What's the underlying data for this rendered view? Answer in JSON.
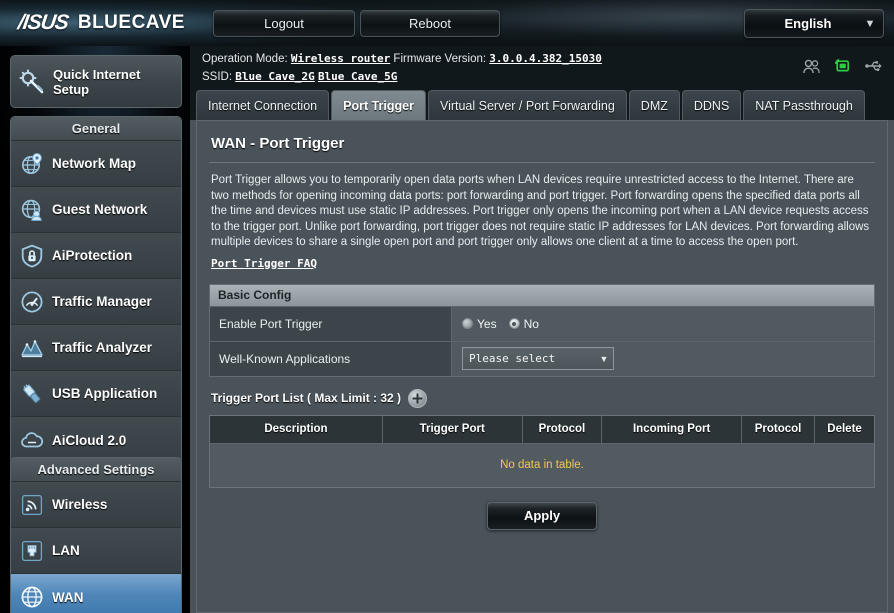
{
  "header": {
    "brand": "/ISUS",
    "model": "BLUECAVE",
    "logout_label": "Logout",
    "reboot_label": "Reboot",
    "language": "English"
  },
  "sidebar": {
    "quick_setup": "Quick Internet Setup",
    "groups": [
      {
        "title": "General",
        "items": [
          {
            "label": "Network Map",
            "icon": "network-map-icon",
            "active": false
          },
          {
            "label": "Guest Network",
            "icon": "guest-network-icon",
            "active": false
          },
          {
            "label": "AiProtection",
            "icon": "shield-lock-icon",
            "active": false
          },
          {
            "label": "Traffic Manager",
            "icon": "gauge-icon",
            "active": false
          },
          {
            "label": "Traffic Analyzer",
            "icon": "chart-icon",
            "active": false
          },
          {
            "label": "USB Application",
            "icon": "usb-icon",
            "active": false
          },
          {
            "label": "AiCloud 2.0",
            "icon": "cloud-icon",
            "active": false
          }
        ]
      },
      {
        "title": "Advanced Settings",
        "items": [
          {
            "label": "Wireless",
            "icon": "wireless-icon",
            "active": false
          },
          {
            "label": "LAN",
            "icon": "lan-port-icon",
            "active": false
          },
          {
            "label": "WAN",
            "icon": "globe-icon",
            "active": true
          }
        ]
      }
    ]
  },
  "status": {
    "operation_mode_label": "Operation Mode:",
    "operation_mode_value": "Wireless router",
    "firmware_label": "Firmware Version:",
    "firmware_value": "3.0.0.4.382_15030",
    "ssid_label": "SSID:",
    "ssid_2g": "Blue Cave_2G",
    "ssid_5g": "Blue Cave_5G",
    "icons": [
      "clients-icon",
      "usb-device-icon",
      "usb-icon"
    ]
  },
  "tabs": [
    {
      "label": "Internet Connection",
      "active": false
    },
    {
      "label": "Port Trigger",
      "active": true
    },
    {
      "label": "Virtual Server / Port Forwarding",
      "active": false
    },
    {
      "label": "DMZ",
      "active": false
    },
    {
      "label": "DDNS",
      "active": false
    },
    {
      "label": "NAT Passthrough",
      "active": false
    }
  ],
  "page": {
    "title": "WAN - Port Trigger",
    "description": "Port Trigger allows you to temporarily open data ports when LAN devices require unrestricted access to the Internet. There are two methods for opening incoming data ports: port forwarding and port trigger. Port forwarding opens the specified data ports all the time and devices must use static IP addresses. Port trigger only opens the incoming port when a LAN device requests access to the trigger port. Unlike port forwarding, port trigger does not require static IP addresses for LAN devices. Port forwarding allows multiple devices to share a single open port and port trigger only allows one client at a time to access the open port.",
    "faq_link": "Port Trigger FAQ"
  },
  "basic_config": {
    "panel_title": "Basic Config",
    "enable_label": "Enable Port Trigger",
    "enable_options": [
      {
        "label": "Yes",
        "checked": false
      },
      {
        "label": "No",
        "checked": true
      }
    ],
    "apps_label": "Well-Known Applications",
    "apps_value": "Please select"
  },
  "trigger_list": {
    "title": "Trigger Port List ( Max Limit : 32 )",
    "add_label": "+",
    "columns": [
      "Description",
      "Trigger Port",
      "Protocol",
      "Incoming Port",
      "Protocol",
      "Delete"
    ],
    "rows": [],
    "empty_text": "No data in table."
  },
  "footer": {
    "apply_label": "Apply"
  },
  "colors": {
    "accent_blue": "#4e86b8",
    "panel_bg": "#4a5359",
    "empty_text": "#f2c94c",
    "status_active": "#2ecc40"
  }
}
